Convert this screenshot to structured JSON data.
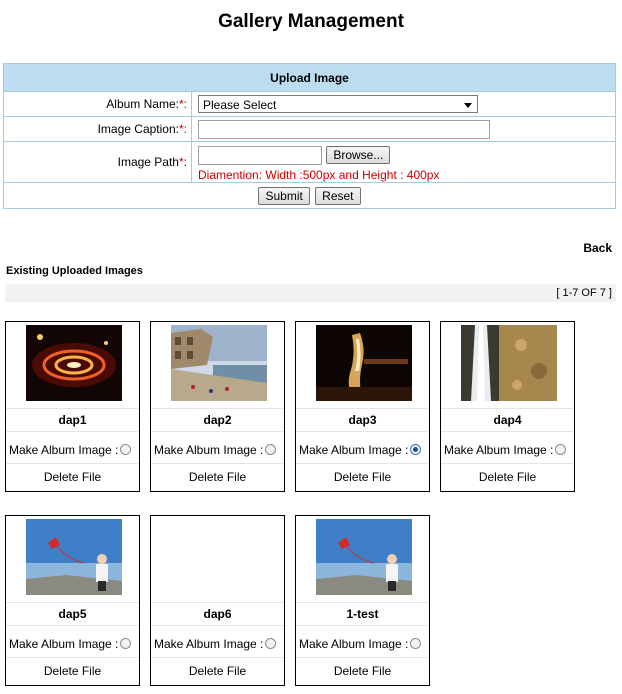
{
  "page": {
    "title": "Gallery Management"
  },
  "upload": {
    "header": "Upload Image",
    "album_label": "Album Name:",
    "album_value": "Please Select",
    "caption_label": "Image Caption:",
    "caption_value": "",
    "path_label": "Image Path",
    "browse_label": "Browse...",
    "hint": "Diamention: Width :500px and Height : 400px",
    "submit_label": "Submit",
    "reset_label": "Reset",
    "required_mark": "*",
    "required_mark_colon": "*:"
  },
  "back_label": "Back",
  "existing_title": "Existing Uploaded Images",
  "pager": "[ 1-7 OF 7 ]",
  "images": [
    {
      "name": "dap1",
      "album_label": "Make Album Image :",
      "selected": false,
      "delete_label": "Delete File",
      "thumb": "sparkler-icon"
    },
    {
      "name": "dap2",
      "album_label": "Make Album Image :",
      "selected": false,
      "delete_label": "Delete File",
      "thumb": "riverside-icon"
    },
    {
      "name": "dap3",
      "album_label": "Make Album Image :",
      "selected": true,
      "delete_label": "Delete File",
      "thumb": "night-light-icon"
    },
    {
      "name": "dap4",
      "album_label": "Make Album Image :",
      "selected": false,
      "delete_label": "Delete File",
      "thumb": "waterfall-icon"
    },
    {
      "name": "dap5",
      "album_label": "Make Album Image :",
      "selected": false,
      "delete_label": "Delete File",
      "thumb": "kite-icon"
    },
    {
      "name": "dap6",
      "album_label": "Make Album Image :",
      "selected": false,
      "delete_label": "Delete File",
      "thumb": ""
    },
    {
      "name": "1-test",
      "album_label": "Make Album Image :",
      "selected": false,
      "delete_label": "Delete File",
      "thumb": "kite-icon"
    }
  ],
  "colors": {
    "header_bg": "#bcdcf0",
    "border": "#a7cbe3",
    "required": "#cc0000"
  }
}
